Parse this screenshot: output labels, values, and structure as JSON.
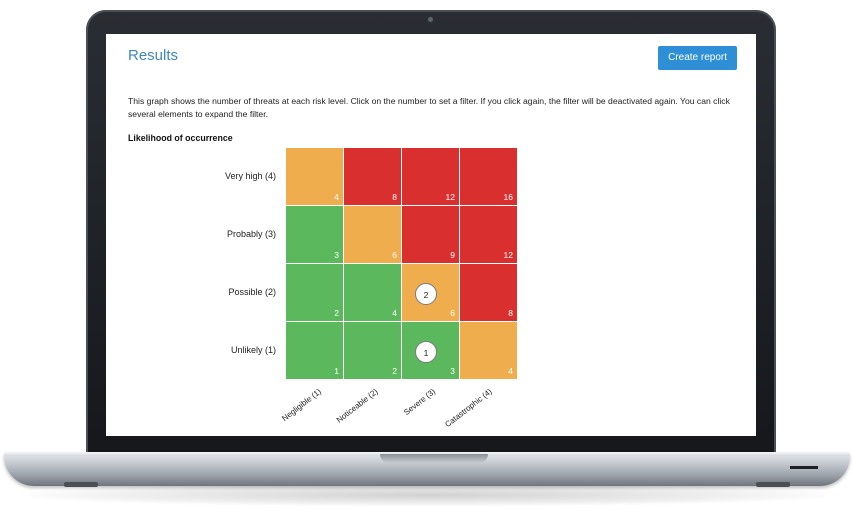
{
  "page": {
    "title": "Results",
    "create_report_label": "Create report",
    "description": "This graph shows the number of threats at each risk level. Click on the number to set a filter. If you click again, the filter will be deactivated again. You can click several elements to expand the filter.",
    "section_title": "Likelihood of occurrence"
  },
  "risk_matrix": {
    "colors": {
      "low": "#5cb85c",
      "medium": "#f0ad4e",
      "high": "#d9302f"
    },
    "rows": [
      {
        "label": "Very high (4)",
        "cells": [
          {
            "value": "4",
            "level": "medium"
          },
          {
            "value": "8",
            "level": "high"
          },
          {
            "value": "12",
            "level": "high"
          },
          {
            "value": "16",
            "level": "high"
          }
        ]
      },
      {
        "label": "Probably (3)",
        "cells": [
          {
            "value": "3",
            "level": "low"
          },
          {
            "value": "6",
            "level": "medium"
          },
          {
            "value": "9",
            "level": "high"
          },
          {
            "value": "12",
            "level": "high"
          }
        ]
      },
      {
        "label": "Possible (2)",
        "cells": [
          {
            "value": "2",
            "level": "low"
          },
          {
            "value": "4",
            "level": "low"
          },
          {
            "value": "6",
            "level": "medium",
            "threat_count": "2"
          },
          {
            "value": "8",
            "level": "high"
          }
        ]
      },
      {
        "label": "Unlikely (1)",
        "cells": [
          {
            "value": "1",
            "level": "low"
          },
          {
            "value": "2",
            "level": "low"
          },
          {
            "value": "3",
            "level": "low",
            "threat_count": "1"
          },
          {
            "value": "4",
            "level": "medium"
          }
        ]
      }
    ],
    "columns": [
      "Negligible (1)",
      "Noticeable (2)",
      "Severe (3)",
      "Catastrophic (4)"
    ]
  }
}
